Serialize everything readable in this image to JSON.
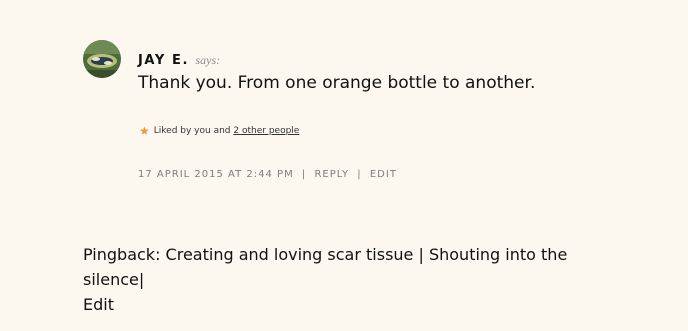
{
  "comment": {
    "author": "JAY E.",
    "says": "says:",
    "text": "Thank you. From one orange bottle to another.",
    "likes": {
      "prefix": "Liked by you and",
      "link": "2 other people"
    },
    "meta": {
      "date": "17 APRIL 2015 AT 2:44 PM",
      "sep": "|",
      "reply": "REPLY",
      "edit": "EDIT"
    }
  },
  "pingback": {
    "label": "Pingback:",
    "link_title": "Creating and loving scar tissue",
    "sep": "|",
    "site": "Shouting into the silence",
    "edit": "Edit"
  },
  "icons": {
    "star": "star-icon",
    "avatar": "avatar"
  },
  "colors": {
    "background": "#fcf8f0",
    "star": "#e99b35",
    "meta": "#7d7d7d"
  }
}
